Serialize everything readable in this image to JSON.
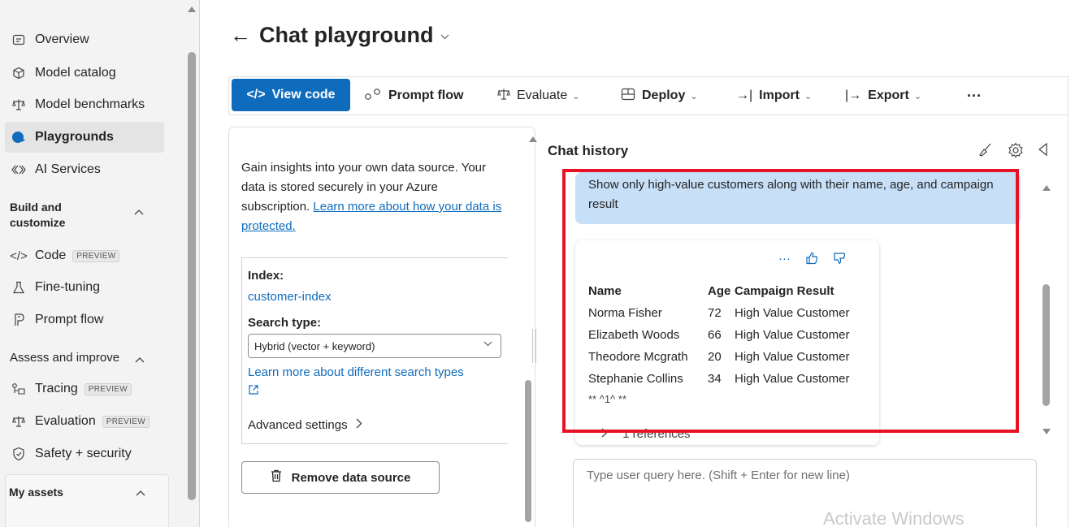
{
  "sidebar": {
    "items": [
      {
        "label": "Overview",
        "icon": "overview-icon"
      },
      {
        "label": "Model catalog",
        "icon": "model-catalog-icon"
      },
      {
        "label": "Model benchmarks",
        "icon": "benchmarks-icon"
      },
      {
        "label": "Playgrounds",
        "icon": "playgrounds-icon",
        "active": true
      },
      {
        "label": "AI Services",
        "icon": "ai-services-icon"
      },
      {
        "label": "Code",
        "icon": "code-icon",
        "badge": "PREVIEW"
      },
      {
        "label": "Fine-tuning",
        "icon": "fine-tuning-icon"
      },
      {
        "label": "Prompt flow",
        "icon": "prompt-flow-icon"
      },
      {
        "label": "Tracing",
        "icon": "tracing-icon",
        "badge": "PREVIEW"
      },
      {
        "label": "Evaluation",
        "icon": "evaluation-icon",
        "badge": "PREVIEW"
      },
      {
        "label": "Safety + security",
        "icon": "shield-icon"
      }
    ],
    "sections": {
      "build_line1": "Build and",
      "build_line2": "customize",
      "assess": "Assess and improve",
      "my_assets": "My assets"
    }
  },
  "header": {
    "title": "Chat playground"
  },
  "toolbar": {
    "view_code": "View code",
    "prompt_flow": "Prompt flow",
    "evaluate": "Evaluate",
    "deploy": "Deploy",
    "import": "Import",
    "export": "Export",
    "more": "···"
  },
  "data_panel": {
    "intro_text": "Gain insights into your own data source. Your data is stored securely in your Azure subscription.",
    "intro_link": "Learn more about how your data is protected.",
    "index_label": "Index:",
    "index_value": "customer-index",
    "search_type_label": "Search type:",
    "search_type_value": "Hybrid (vector + keyword)",
    "search_types_link": "Learn more about different search types",
    "advanced_settings": "Advanced settings",
    "remove_button": "Remove data source"
  },
  "chat": {
    "title": "Chat history",
    "user_message": "Show only high-value customers along with their name, age, and campaign result",
    "columns": [
      "Name",
      "Age",
      "Campaign Result"
    ],
    "rows": [
      [
        "Norma Fisher",
        "72",
        "High Value Customer"
      ],
      [
        "Elizabeth Woods",
        "66",
        "High Value Customer"
      ],
      [
        "Theodore Mcgrath",
        "20",
        "High Value Customer"
      ],
      [
        "Stephanie Collins",
        "34",
        "High Value Customer"
      ]
    ],
    "footnote": "** ^1^ **",
    "references": "1 references",
    "input_placeholder": "Type user query here. (Shift + Enter for new line)",
    "watermark": "Activate Windows"
  },
  "colors": {
    "accent": "#0f6cbd",
    "user_bubble": "#c7dff7",
    "highlight": "#e81224"
  }
}
